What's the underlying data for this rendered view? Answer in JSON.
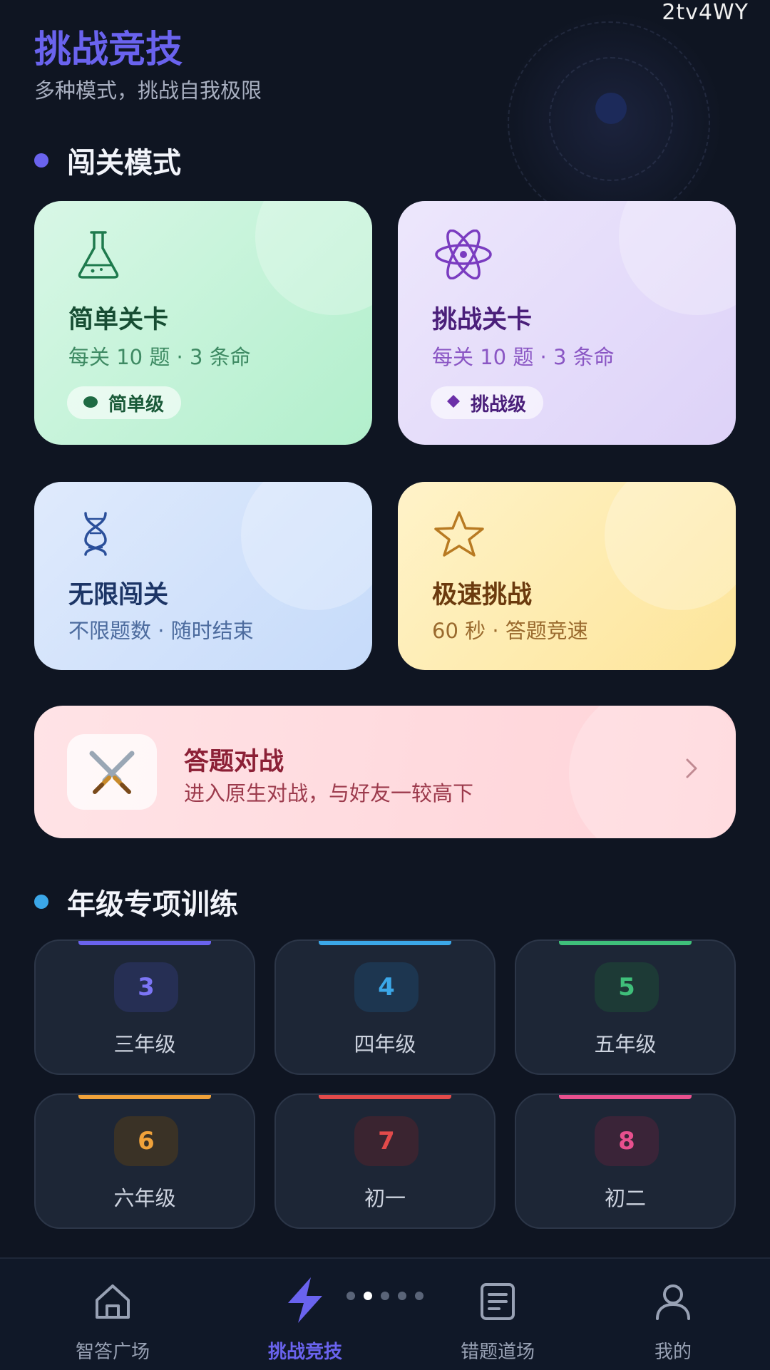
{
  "watermark": "2tv4WY",
  "header": {
    "title": "挑战竞技",
    "subtitle": "多种模式，挑战自我极限"
  },
  "sections": {
    "level_mode": {
      "title": "闯关模式",
      "dot_color": "#6a63ee"
    },
    "grade_training": {
      "title": "年级专项训练",
      "dot_color": "#3ba7e8"
    }
  },
  "modes": [
    {
      "title": "简单关卡",
      "desc": "每关 10 题 · 3 条命",
      "badge": "简单级",
      "icon": "flask-icon",
      "accent": "#1e7a4d"
    },
    {
      "title": "挑战关卡",
      "desc": "每关 10 题 · 3 条命",
      "badge": "挑战级",
      "icon": "atom-icon",
      "accent": "#6b2fa8"
    },
    {
      "title": "无限闯关",
      "desc": "不限题数 · 随时结束",
      "icon": "dna-icon",
      "accent": "#1f3f80"
    },
    {
      "title": "极速挑战",
      "desc": "60 秒 · 答题竞速",
      "icon": "star-icon",
      "accent": "#8a4b12"
    }
  ],
  "battle": {
    "title": "答题对战",
    "desc": "进入原生对战，与好友一较高下",
    "icon": "crossed-swords-icon"
  },
  "grades": [
    {
      "number": "3",
      "label": "三年级",
      "color": "#6a63ee"
    },
    {
      "number": "4",
      "label": "四年级",
      "color": "#3ba7e8"
    },
    {
      "number": "5",
      "label": "五年级",
      "color": "#3fbf7a"
    },
    {
      "number": "6",
      "label": "六年级",
      "color": "#f0a23a"
    },
    {
      "number": "7",
      "label": "初一",
      "color": "#e24a4a"
    },
    {
      "number": "8",
      "label": "初二",
      "color": "#e8508e"
    }
  ],
  "nav": [
    {
      "label": "智答广场",
      "icon": "home-icon",
      "active": false
    },
    {
      "label": "挑战竞技",
      "icon": "lightning-icon",
      "active": true
    },
    {
      "label": "错题道场",
      "icon": "notebook-icon",
      "active": false
    },
    {
      "label": "我的",
      "icon": "user-icon",
      "active": false
    }
  ]
}
